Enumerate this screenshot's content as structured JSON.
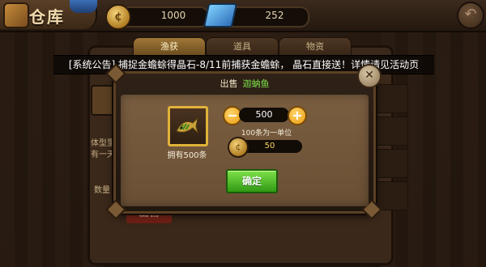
{
  "header": {
    "title": "仓库",
    "gold": "1000",
    "gems": "252"
  },
  "tabs": [
    {
      "label": "渔获"
    },
    {
      "label": "道具"
    },
    {
      "label": "物资"
    }
  ],
  "background_panel": {
    "text_1": "体型里",
    "text_2": "有一天",
    "quantity_label": "数量",
    "sell_label": "出售"
  },
  "announcement": "[系统公告] 捕捉金蟾蜍得晶石-8/11前捕获金蟾蜍， 晶石直接送！详情请见活动页",
  "dialog": {
    "title": "出售",
    "item_name": "迦蚋鱼",
    "owned": "拥有500条",
    "quantity": "500",
    "unit_note": "100条为一单位",
    "price": "50",
    "confirm": "确定",
    "minus": "−",
    "plus": "+"
  },
  "colors": {
    "accent_green": "#7fe14a",
    "gold": "#e0b23a",
    "price_text": "#f7d35a"
  }
}
